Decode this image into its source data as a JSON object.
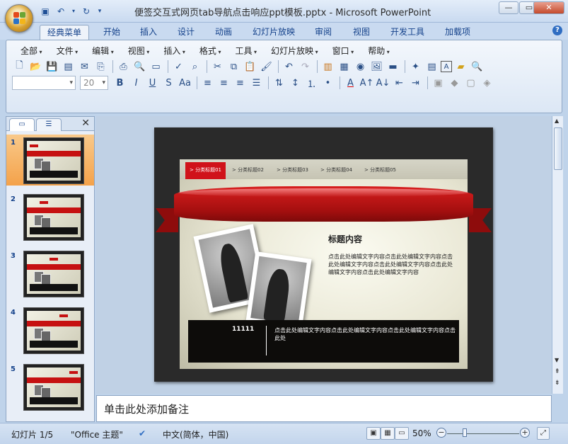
{
  "window": {
    "title": "便签交互式网页tab导航点击响应ppt模板.pptx - Microsoft PowerPoint"
  },
  "tabs": [
    "经典菜单",
    "开始",
    "插入",
    "设计",
    "动画",
    "幻灯片放映",
    "审阅",
    "视图",
    "开发工具",
    "加载项"
  ],
  "menus": [
    "全部",
    "文件",
    "编辑",
    "视图",
    "插入",
    "格式",
    "工具",
    "幻灯片放映",
    "窗口",
    "帮助"
  ],
  "format": {
    "font_size": "20"
  },
  "slides_panel": {
    "numbers": [
      "1",
      "2",
      "3",
      "4",
      "5"
    ]
  },
  "slide": {
    "tabs": [
      "> 分类标题01",
      "> 分类标题02",
      "> 分类标题03",
      "> 分类标题04",
      "> 分类标题05"
    ],
    "heading": "标题内容",
    "body": "点击此处编辑文字内容点击此处编辑文字内容点击此处编辑文字内容点击此处编辑文字内容点击此处编辑文字内容点击此处编辑文字内容",
    "bar_number": "11111",
    "bar_text": "点击此处编辑文字内容点击此处编辑文字内容点击此处编辑文字内容点击此处"
  },
  "notes": {
    "placeholder": "单击此处添加备注"
  },
  "status": {
    "slide": "幻灯片 1/5",
    "theme": "\"Office 主题\"",
    "language": "中文(简体，中国)",
    "zoom": "50%"
  }
}
